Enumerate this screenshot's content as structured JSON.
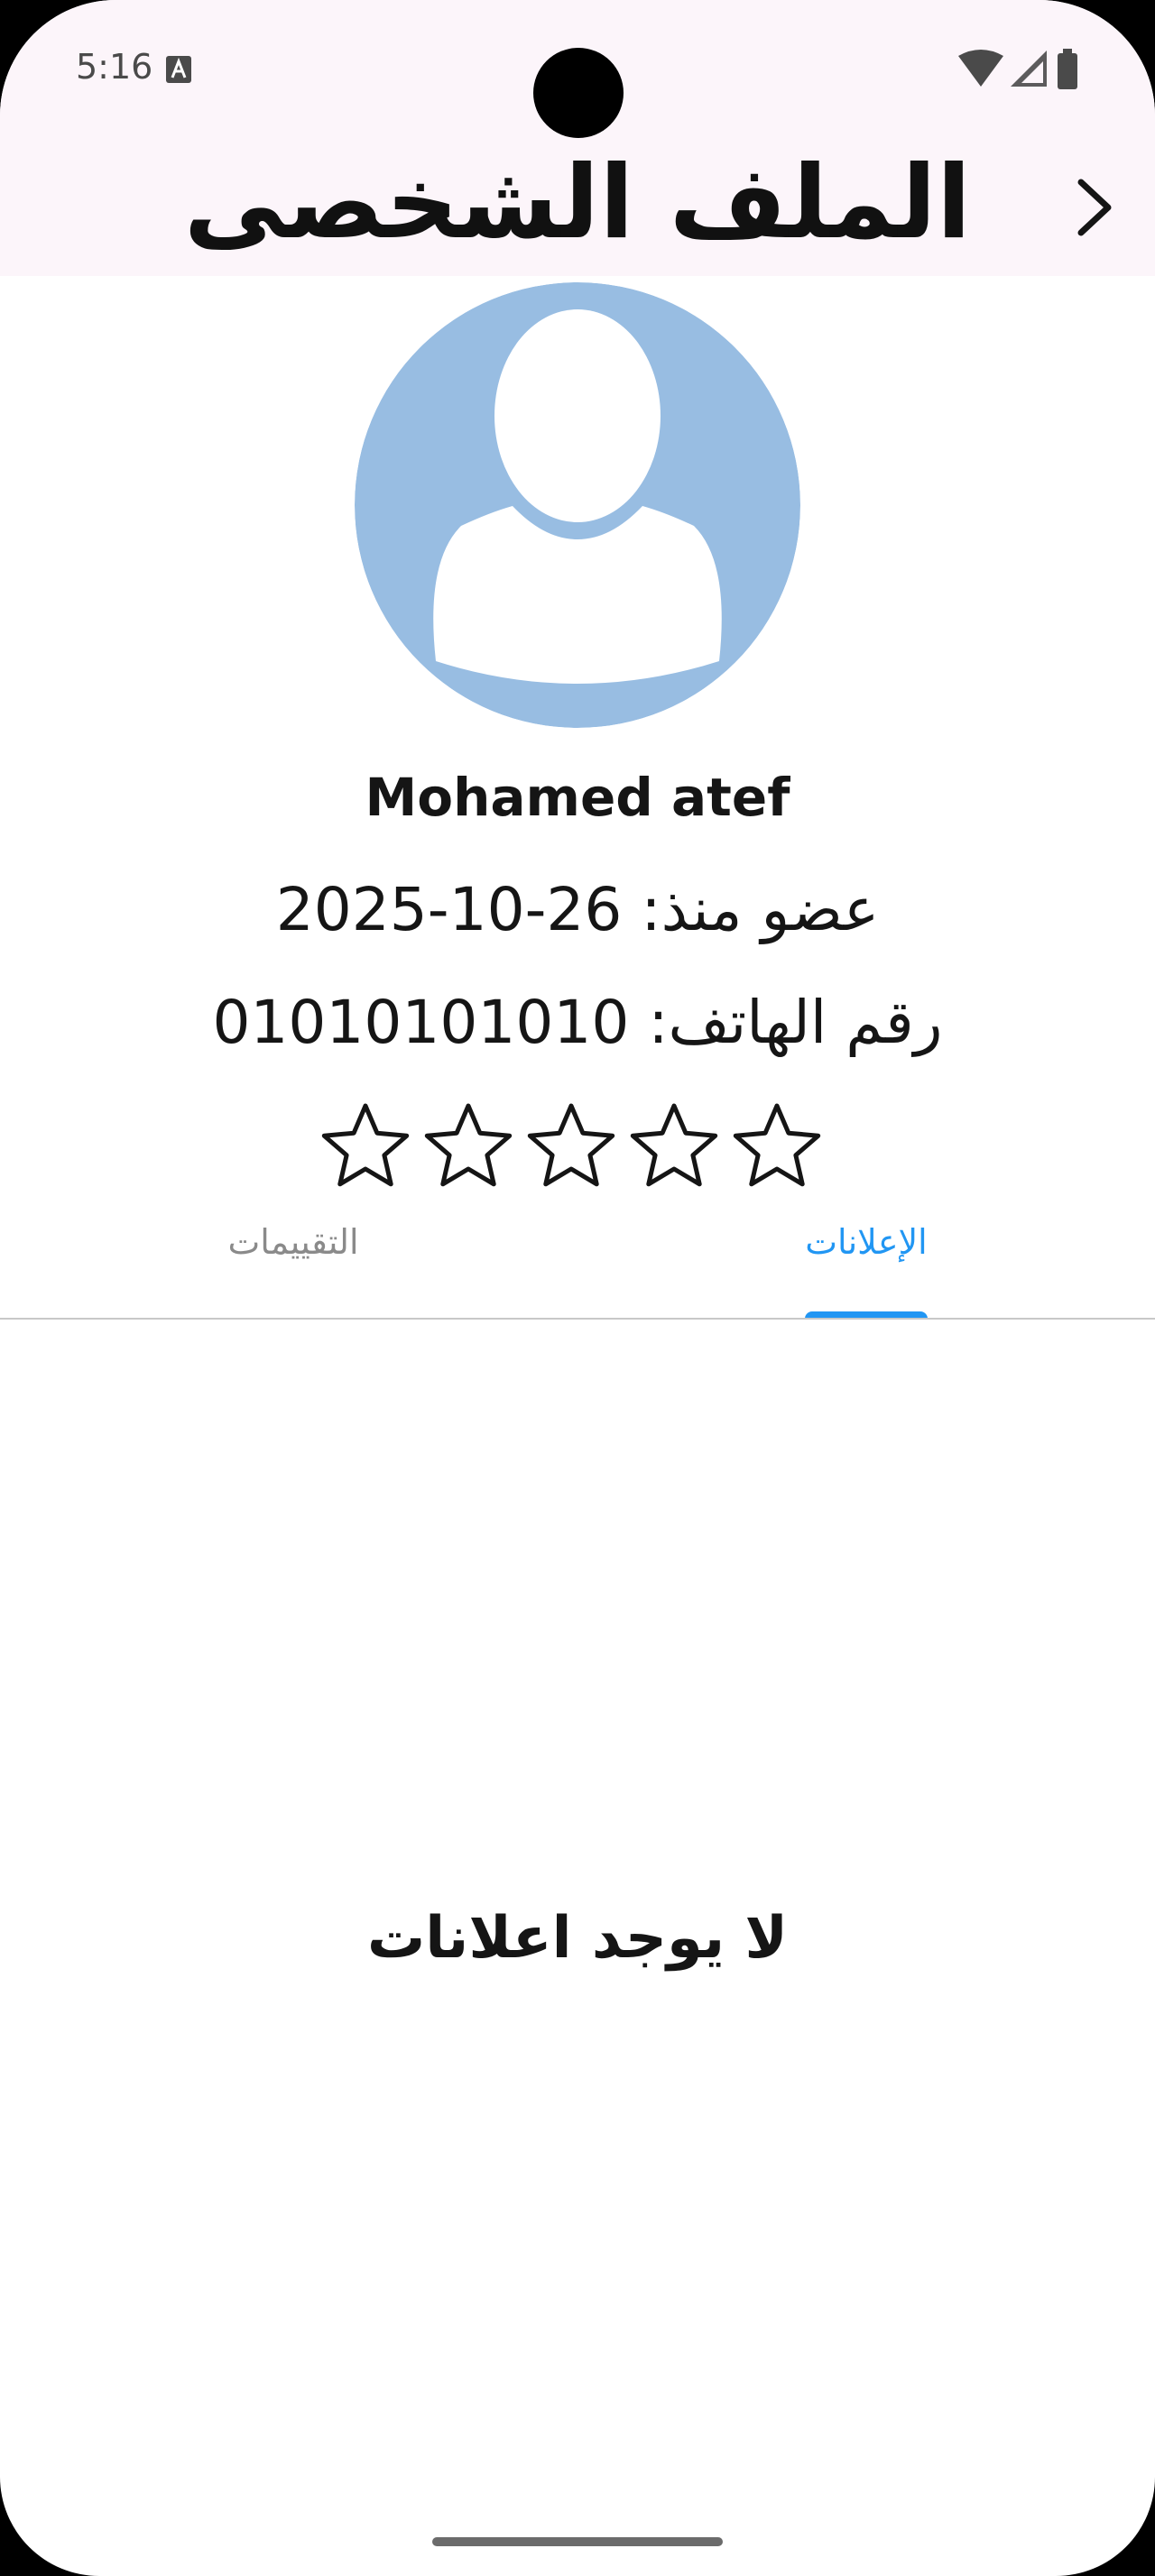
{
  "status_bar": {
    "time": "5:16",
    "icons": [
      "a-notification-icon",
      "wifi-icon",
      "cellular-signal-icon",
      "battery-icon"
    ]
  },
  "app_bar": {
    "title": "الملف الشخصى",
    "back_icon": "chevron-right-icon"
  },
  "profile": {
    "avatar_icon": "person-avatar-icon",
    "name": "Mohamed atef",
    "member_since": "عضو منذ: 26-10-2025",
    "phone": "رقم الهاتف: 01010101010",
    "rating": 0,
    "rating_max": 5
  },
  "tabs": [
    {
      "label": "الإعلانات",
      "selected": true
    },
    {
      "label": "التقييمات",
      "selected": false
    }
  ],
  "content": {
    "empty_message": "لا يوجد اعلانات"
  },
  "colors": {
    "app_bar_background": "#fcf5fa",
    "accent": "#2196f3",
    "avatar_background": "#98bde2",
    "text": "#151515",
    "inactive_tab": "#8a8a8a"
  }
}
